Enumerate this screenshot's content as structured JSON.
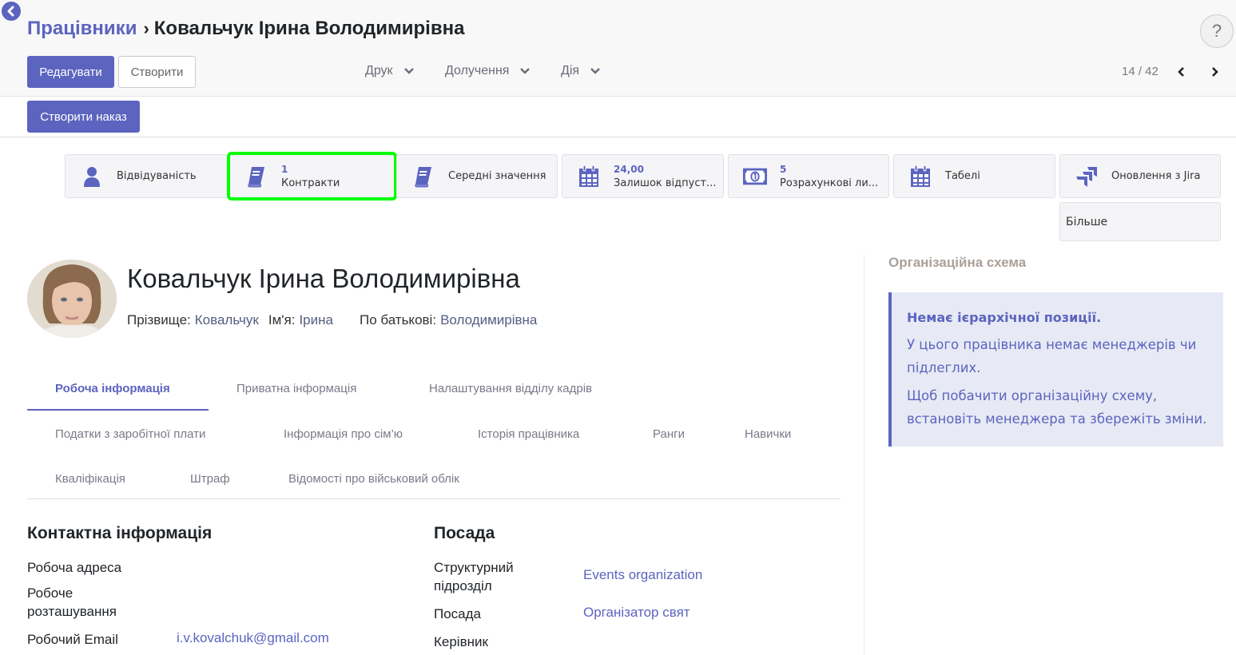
{
  "header": {
    "breadcrumb_parent": "Працівники",
    "breadcrumb_separator": "›",
    "breadcrumb_current": "Ковальчук Ірина Володимирівна",
    "help_label": "?"
  },
  "toolbar": {
    "edit_label": "Редагувати",
    "create_label": "Створити",
    "dropdowns": [
      {
        "label": "Друк"
      },
      {
        "label": "Долучення"
      },
      {
        "label": "Дія"
      }
    ],
    "pager": "14 / 42"
  },
  "statusbar": {
    "create_order_label": "Створити наказ"
  },
  "smart_buttons": [
    {
      "icon": "user-icon",
      "value": "",
      "label": "Відвідуваність"
    },
    {
      "icon": "book-icon",
      "value": "1",
      "label": "Контракти",
      "highlighted": true
    },
    {
      "icon": "book-icon",
      "value": "",
      "label": "Середні значення"
    },
    {
      "icon": "calendar-icon",
      "value": "24,00",
      "label": "Залишок відпуст..."
    },
    {
      "icon": "money-icon",
      "value": "5",
      "label": "Розрахункові ли..."
    },
    {
      "icon": "calendar-icon",
      "value": "",
      "label": "Табелі"
    },
    {
      "icon": "jira-icon",
      "value": "",
      "label": "Оновлення з Jira"
    },
    {
      "icon": "",
      "value": "",
      "label": "Більше"
    }
  ],
  "employee": {
    "full_name": "Ковальчук Ірина Володимирівна",
    "last_name_label": "Прізвище:",
    "last_name": "Ковальчук",
    "first_name_label": "Ім'я:",
    "first_name": "Ірина",
    "middle_name_label": "По батькові:",
    "middle_name": "Володимирівна"
  },
  "tabs": [
    {
      "label": "Робоча інформація",
      "active": true
    },
    {
      "label": "Приватна інформація"
    },
    {
      "label": "Налаштування відділу кадрів"
    },
    {
      "label": "Податки з заробітної плати"
    },
    {
      "label": "Інформація про сім’ю"
    },
    {
      "label": "Історія працівника"
    },
    {
      "label": "Ранги"
    },
    {
      "label": "Навички"
    },
    {
      "label": "Кваліфікація"
    },
    {
      "label": "Штраф"
    },
    {
      "label": "Відомості про військовий облік"
    }
  ],
  "contact": {
    "title": "Контактна інформація",
    "work_address_label": "Робоча адреса",
    "work_location_label": "Робоче розташування",
    "work_email_label": "Робочий Email",
    "work_email": "i.v.kovalchuk@gmail.com"
  },
  "position": {
    "title": "Посада",
    "department_label": "Структурний підрозділ",
    "department": "Events organization",
    "job_label": "Посада",
    "job": "Організатор свят",
    "manager_label": "Керівник"
  },
  "org_chart": {
    "title": "Організаційна схема",
    "alert_title": "Немає ієрархічної позиції.",
    "alert_p1": "У цього працівника немає менеджерів чи підлеглих.",
    "alert_p2": "Щоб побачити організаційну схему, встановіть менеджера та збережіть зміни."
  },
  "colors": {
    "accent": "#5b64bf",
    "highlight": "#00ff00",
    "alert_bg": "#e7eaf4"
  }
}
